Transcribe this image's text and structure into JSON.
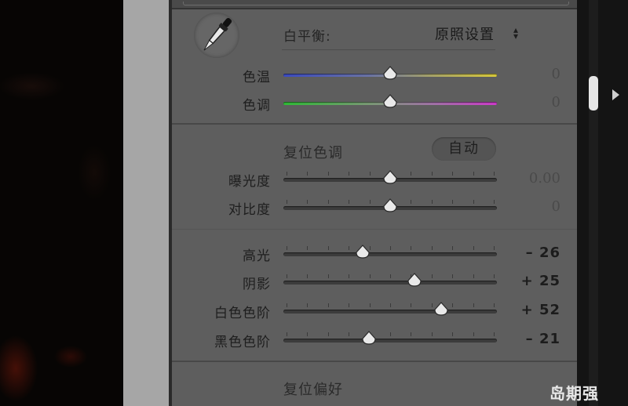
{
  "white_balance": {
    "label": "白平衡:",
    "value": "原照设置",
    "select_icon": "updown-chevron-icon",
    "tool_icon": "eyedropper-icon",
    "sliders": [
      {
        "label": "色温",
        "value": "0",
        "position": 0.5,
        "kind": "temp"
      },
      {
        "label": "色调",
        "value": "0",
        "position": 0.5,
        "kind": "tint"
      }
    ]
  },
  "tone": {
    "reset_label": "复位色调",
    "auto_label": "自动",
    "sliders": [
      {
        "label": "曝光度",
        "value": "0.00",
        "position": 0.5
      },
      {
        "label": "对比度",
        "value": "0",
        "position": 0.5
      }
    ]
  },
  "tone_detail": {
    "sliders": [
      {
        "label": "高光",
        "value": "– 26",
        "position": 0.37
      },
      {
        "label": "阴影",
        "value": "+ 25",
        "position": 0.615
      },
      {
        "label": "白色色阶",
        "value": "+ 52",
        "position": 0.74
      },
      {
        "label": "黑色色阶",
        "value": "– 21",
        "position": 0.4
      }
    ]
  },
  "presence": {
    "reset_label": "复位偏好"
  },
  "watermark": "岛期强",
  "colors": {
    "panel": "#5e5e5e",
    "gutter": "#a6a6a6",
    "temp_start": "#3b4bc2",
    "temp_end": "#dacb3b",
    "tint_start": "#2fbd36",
    "tint_end": "#cf3bcc"
  }
}
